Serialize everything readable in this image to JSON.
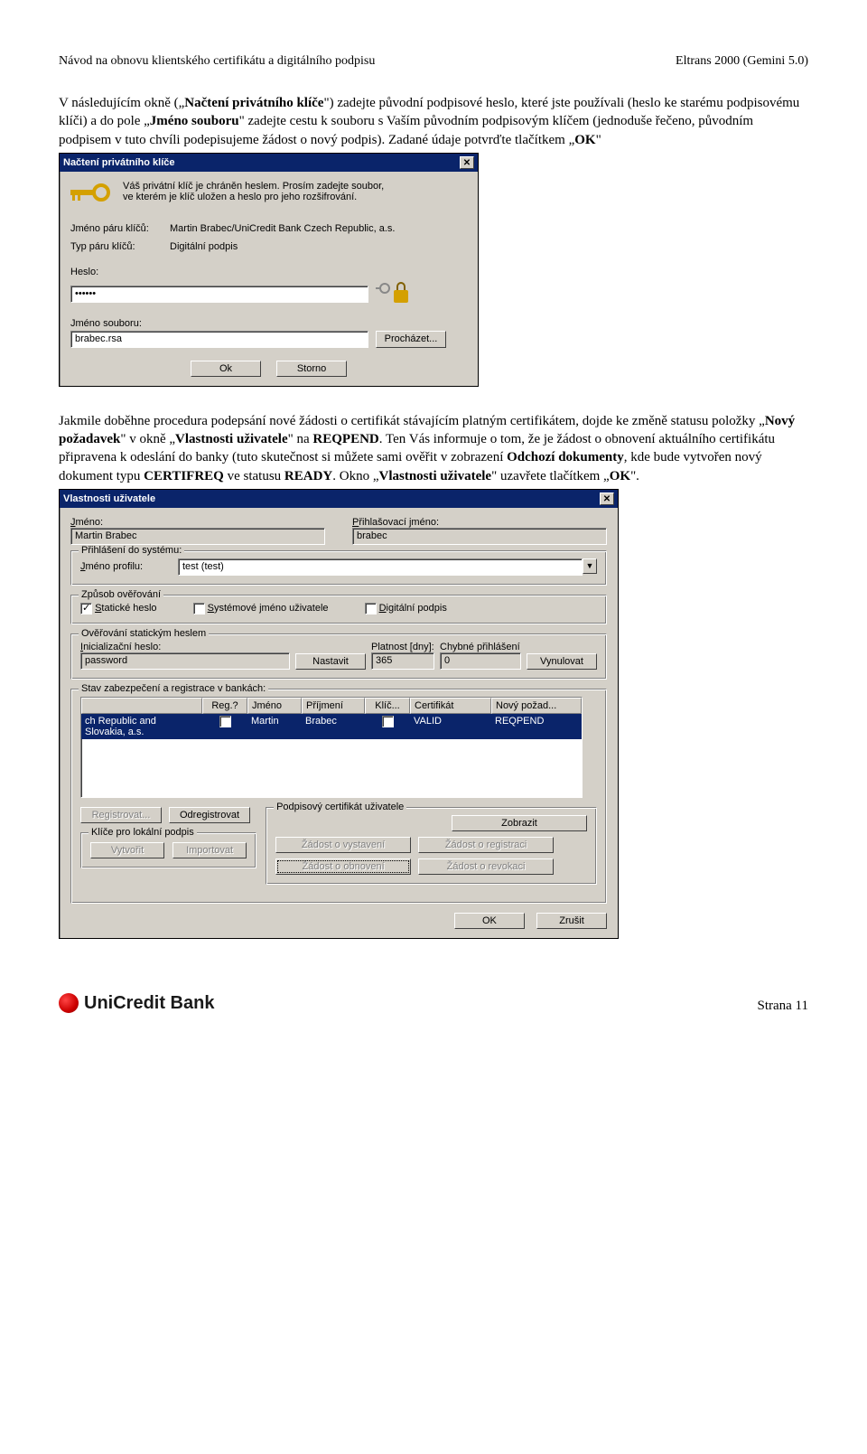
{
  "header": {
    "left": "Návod na obnovu klientského certifikátu a digitálního podpisu",
    "right": "Eltrans 2000 (Gemini 5.0)"
  },
  "para1_before": "V následujícím okně („",
  "para1_bold1": "Načtení privátního klíče",
  "para1_mid1": "\") zadejte původní podpisové heslo, které jste používali (heslo ke starému podpisovému klíči) a do pole „",
  "para1_bold2": "Jméno souboru",
  "para1_after": "\" zadejte cestu k souboru s Vaším původním podpisovým klíčem (jednoduše řečeno, původním podpisem v tuto chvíli podepisujeme žádost o nový podpis). Zadané údaje potvrďte tlačítkem „",
  "para1_bold3": "OK",
  "para1_tail": "\"",
  "dlg1": {
    "title": "Načtení privátního klíče",
    "info": "Váš privátní klíč je chráněn heslem. Prosím zadejte soubor, ve kterém je klíč uložen a heslo pro jeho rozšifrování.",
    "lbl_pair": "Jméno páru klíčů:",
    "val_pair": "Martin Brabec/UniCredit Bank Czech Republic, a.s.",
    "lbl_type": "Typ páru klíčů:",
    "val_type": "Digitální podpis",
    "lbl_pass": "Heslo:",
    "val_pass": "••••••",
    "lbl_file": "Jméno souboru:",
    "val_file": "brabec.rsa",
    "btn_browse": "Procházet...",
    "btn_ok": "Ok",
    "btn_cancel": "Storno"
  },
  "para2_a": "Jakmile doběhne procedura podepsání nové žádosti o certifikát stávajícím platným certifikátem, dojde ke změně statusu položky „",
  "para2_b1": "Nový požadavek",
  "para2_b": "\" v okně „",
  "para2_b2": "Vlastnosti uživatele",
  "para2_c": "\" na ",
  "para2_b3": "REQPEND",
  "para2_d": ". Ten Vás informuje o tom, že je žádost o obnovení aktuálního certifikátu připravena k odeslání do banky (tuto skutečnost si můžete sami ověřit v zobrazení ",
  "para2_b4": "Odchozí dokumenty",
  "para2_e": ", kde bude vytvořen nový dokument typu ",
  "para2_b5": "CERTIFREQ",
  "para2_f": " ve statusu ",
  "para2_b6": "READY",
  "para2_g": ". Okno „",
  "para2_b7": "Vlastnosti uživatele",
  "para2_h": "\" uzavřete tlačítkem „",
  "para2_b8": "OK",
  "para2_i": "\".",
  "dlg2": {
    "title": "Vlastnosti uživatele",
    "lbl_jmeno": "Jméno:",
    "val_jmeno": "Martin Brabec",
    "lbl_login": "Přihlašovací jméno:",
    "val_login": "brabec",
    "grp_login": "Přihlášení do systému:",
    "lbl_profile": "Jméno profilu:",
    "val_profile": "test  (test)",
    "grp_auth": "Způsob ověřování",
    "chk_static": "Statické heslo",
    "chk_sys": "Systémové jméno uživatele",
    "chk_dig": "Digitální podpis",
    "grp_static": "Ověřování statickým heslem",
    "lbl_init": "Inicializační heslo:",
    "val_init": "password",
    "btn_set": "Nastavit",
    "lbl_valid": "Platnost [dny]:",
    "val_valid": "365",
    "lbl_bad": "Chybné přihlášení",
    "val_bad": "0",
    "btn_reset": "Vynulovat",
    "grp_banks": "Stav zabezpečení a registrace v bankách:",
    "hdr": {
      "name": "",
      "reg": "Reg.?",
      "jm": "Jméno",
      "pr": "Příjmení",
      "kl": "Klíč...",
      "cert": "Certifikát",
      "np": "Nový požad..."
    },
    "row": {
      "name": "ch Republic and Slovakia, a.s.",
      "jm": "Martin",
      "pr": "Brabec",
      "cert": "VALID",
      "np": "REQPEND"
    },
    "btn_register": "Registrovat...",
    "btn_unregister": "Odregistrovat",
    "grp_cert": "Podpisový certifikát uživatele",
    "btn_show": "Zobrazit",
    "grp_local": "Klíče pro lokální podpis",
    "btn_create": "Vytvořit",
    "btn_import": "Importovat",
    "btn_issue": "Žádost o vystavení",
    "btn_regreq": "Žádost o registraci",
    "btn_renew": "Žádost o obnovení",
    "btn_revoke": "Žádost o revokaci",
    "btn_ok": "OK",
    "btn_cancel": "Zrušit"
  },
  "footer": {
    "logo": "UniCredit Bank",
    "page": "Strana 11"
  }
}
